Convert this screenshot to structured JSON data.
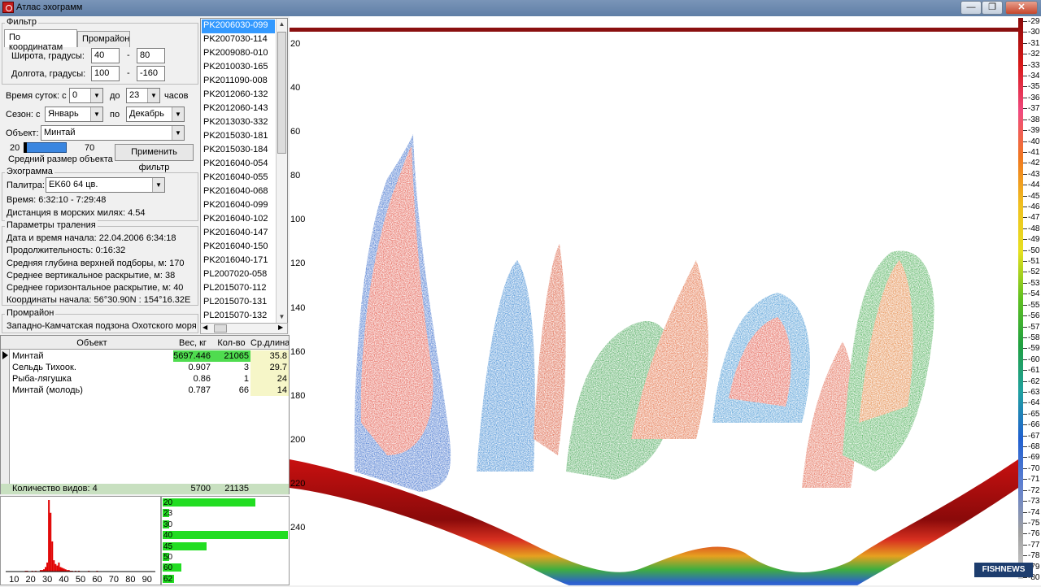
{
  "window": {
    "title": "Атлас эхограмм",
    "minimize": "—",
    "maximize": "❐",
    "close": "✕"
  },
  "filter": {
    "group_label": "Фильтр",
    "tabs": [
      "По координатам",
      "Промрайон"
    ],
    "lat_label": "Широта, градусы:",
    "lat_from": "40",
    "lat_to": "80",
    "lon_label": "Долгота, градусы:",
    "lon_from": "100",
    "lon_to": "-160",
    "dash": "-",
    "time_label": "Время суток: с",
    "time_from": "0",
    "time_to_label": "до",
    "time_to": "23",
    "time_unit": "часов",
    "season_label": "Сезон: с",
    "season_from": "Январь",
    "season_to_label": "по",
    "season_to": "Декабрь",
    "object_label": "Объект:",
    "object_value": "Минтай",
    "size_min": "20",
    "size_max": "70",
    "size_caption": "Средний размер объекта",
    "apply_label": "Применить фильтр"
  },
  "echogram_info": {
    "group_label": "Эхограмма",
    "palette_label": "Палитра:",
    "palette_value": "EK60 64 цв.",
    "time_text": "Время: 6:32:10 - 7:29:48",
    "distance_text": "Дистанция в морских милях: 4.54"
  },
  "trawl": {
    "group_label": "Параметры траления",
    "lines": [
      "Дата и время начала: 22.04.2006 6:34:18",
      "Продолжительность:  0:16:32",
      "Средняя глубина верхней подборы, м:   170",
      "Среднее вертикальное раскрытие, м:   38",
      "Среднее горизонтальное раскрытие, м: 40",
      "Координаты начала:  56°30.90N : 154°16.32E"
    ]
  },
  "region": {
    "group_label": "Промрайон",
    "value": "Западно-Камчатская подзона Охотского моря"
  },
  "records": [
    "PK2006030-099",
    "PK2007030-114",
    "PK2009080-010",
    "PK2010030-165",
    "PK2011090-008",
    "PK2012060-132",
    "PK2012060-143",
    "PK2013030-332",
    "PK2015030-181",
    "PK2015030-184",
    "PK2016040-054",
    "PK2016040-055",
    "PK2016040-068",
    "PK2016040-099",
    "PK2016040-102",
    "PK2016040-147",
    "PK2016040-150",
    "PK2016040-171",
    "PL2007020-058",
    "PL2015070-112",
    "PL2015070-131",
    "PL2015070-132"
  ],
  "catch_table": {
    "headers": [
      "Объект",
      "Вес, кг",
      "Кол-во",
      "Ср.длина"
    ],
    "rows": [
      [
        "Минтай",
        "5697.446",
        "21065",
        "35.8"
      ],
      [
        "Сельдь Тихоок.",
        "0.907",
        "3",
        "29.7"
      ],
      [
        "Рыба-лягушка",
        "0.86",
        "1",
        "24"
      ],
      [
        "Минтай (молодь)",
        "0.787",
        "66",
        "14"
      ]
    ],
    "footer": [
      "Количество видов: 4",
      "5700",
      "21135"
    ]
  },
  "histogram": {
    "x_ticks": [
      "10",
      "20",
      "30",
      "40",
      "50",
      "60",
      "70",
      "80",
      "90"
    ],
    "xlim": [
      5,
      95
    ],
    "values": [
      [
        17,
        1
      ],
      [
        18,
        1
      ],
      [
        21,
        1
      ],
      [
        23,
        1
      ],
      [
        26,
        2
      ],
      [
        27,
        2
      ],
      [
        28,
        3
      ],
      [
        29,
        6
      ],
      [
        30,
        12
      ],
      [
        31,
        95
      ],
      [
        32,
        78
      ],
      [
        33,
        40
      ],
      [
        34,
        15
      ],
      [
        35,
        10
      ],
      [
        36,
        8
      ],
      [
        37,
        12
      ],
      [
        38,
        6
      ],
      [
        39,
        5
      ],
      [
        40,
        4
      ],
      [
        41,
        3
      ],
      [
        42,
        2
      ],
      [
        43,
        2
      ],
      [
        44,
        1
      ],
      [
        45,
        1
      ],
      [
        47,
        1
      ],
      [
        49,
        1
      ],
      [
        55,
        1
      ],
      [
        60,
        1
      ]
    ],
    "color": "#e00000"
  },
  "size_bars": {
    "labels": [
      "20",
      "23",
      "30",
      "40",
      "45",
      "50",
      "60",
      "62"
    ],
    "values": [
      0.74,
      0.02,
      0.03,
      1.0,
      0.35,
      0.01,
      0.15,
      0.09
    ],
    "color": "#22dd22"
  },
  "echogram": {
    "depth_labels": [
      "20",
      "40",
      "60",
      "80",
      "100",
      "120",
      "140",
      "160",
      "180",
      "200",
      "220",
      "240"
    ],
    "depth_min": 0,
    "depth_max": 250
  },
  "color_scale": {
    "labels": [
      "-29",
      "-30",
      "-31",
      "-32",
      "-33",
      "-34",
      "-35",
      "-36",
      "-37",
      "-38",
      "-39",
      "-40",
      "-41",
      "-42",
      "-43",
      "-44",
      "-45",
      "-46",
      "-47",
      "-48",
      "-49",
      "-50",
      "-51",
      "-52",
      "-53",
      "-54",
      "-55",
      "-56",
      "-57",
      "-58",
      "-59",
      "-60",
      "-61",
      "-62",
      "-63",
      "-64",
      "-65",
      "-66",
      "-67",
      "-68",
      "-69",
      "-70",
      "-71",
      "-72",
      "-73",
      "-74",
      "-75",
      "-76",
      "-77",
      "-78",
      "-79",
      "-80"
    ]
  },
  "brand": "FISHNEWS"
}
